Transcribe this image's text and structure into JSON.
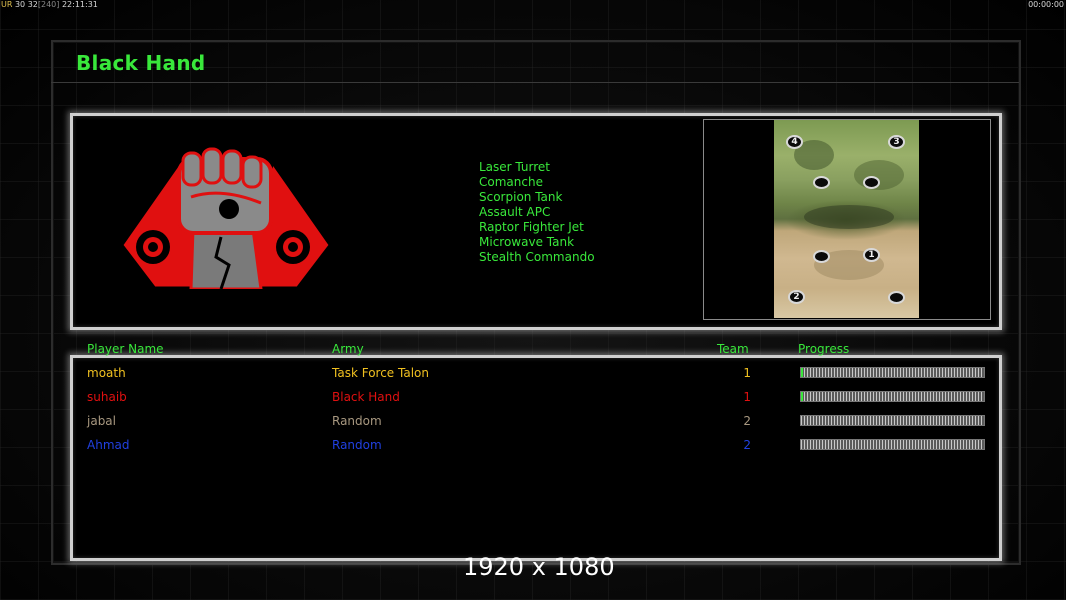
{
  "hud": {
    "left_a": "UR",
    "left_b": "30 32",
    "left_c": "[240]",
    "left_time": "22:11:31",
    "right_time": "00:00:00"
  },
  "title": "Black Hand",
  "faction_logo": "black-hand-fist-emblem",
  "units": [
    "Laser Turret",
    "Comanche",
    "Scorpion Tank",
    "Assault APC",
    "Raptor Fighter Jet",
    "Microwave Tank",
    "Stealth Commando"
  ],
  "map": {
    "start_positions": [
      "4",
      "3",
      "1",
      "2"
    ]
  },
  "columns": {
    "player": "Player Name",
    "army": "Army",
    "team": "Team",
    "progress": "Progress"
  },
  "players": [
    {
      "name": "moath",
      "army": "Task Force Talon",
      "team": "1",
      "progress": 0.01,
      "color": "#f0c020"
    },
    {
      "name": "suhaib",
      "army": "Black Hand",
      "team": "1",
      "progress": 0.01,
      "color": "#e01010"
    },
    {
      "name": "jabal",
      "army": "Random",
      "team": "2",
      "progress": 0,
      "color": "#a89880"
    },
    {
      "name": "Ahmad",
      "army": "Random",
      "team": "2",
      "progress": 0,
      "color": "#2040e0"
    }
  ],
  "resolution": "1920 x 1080"
}
